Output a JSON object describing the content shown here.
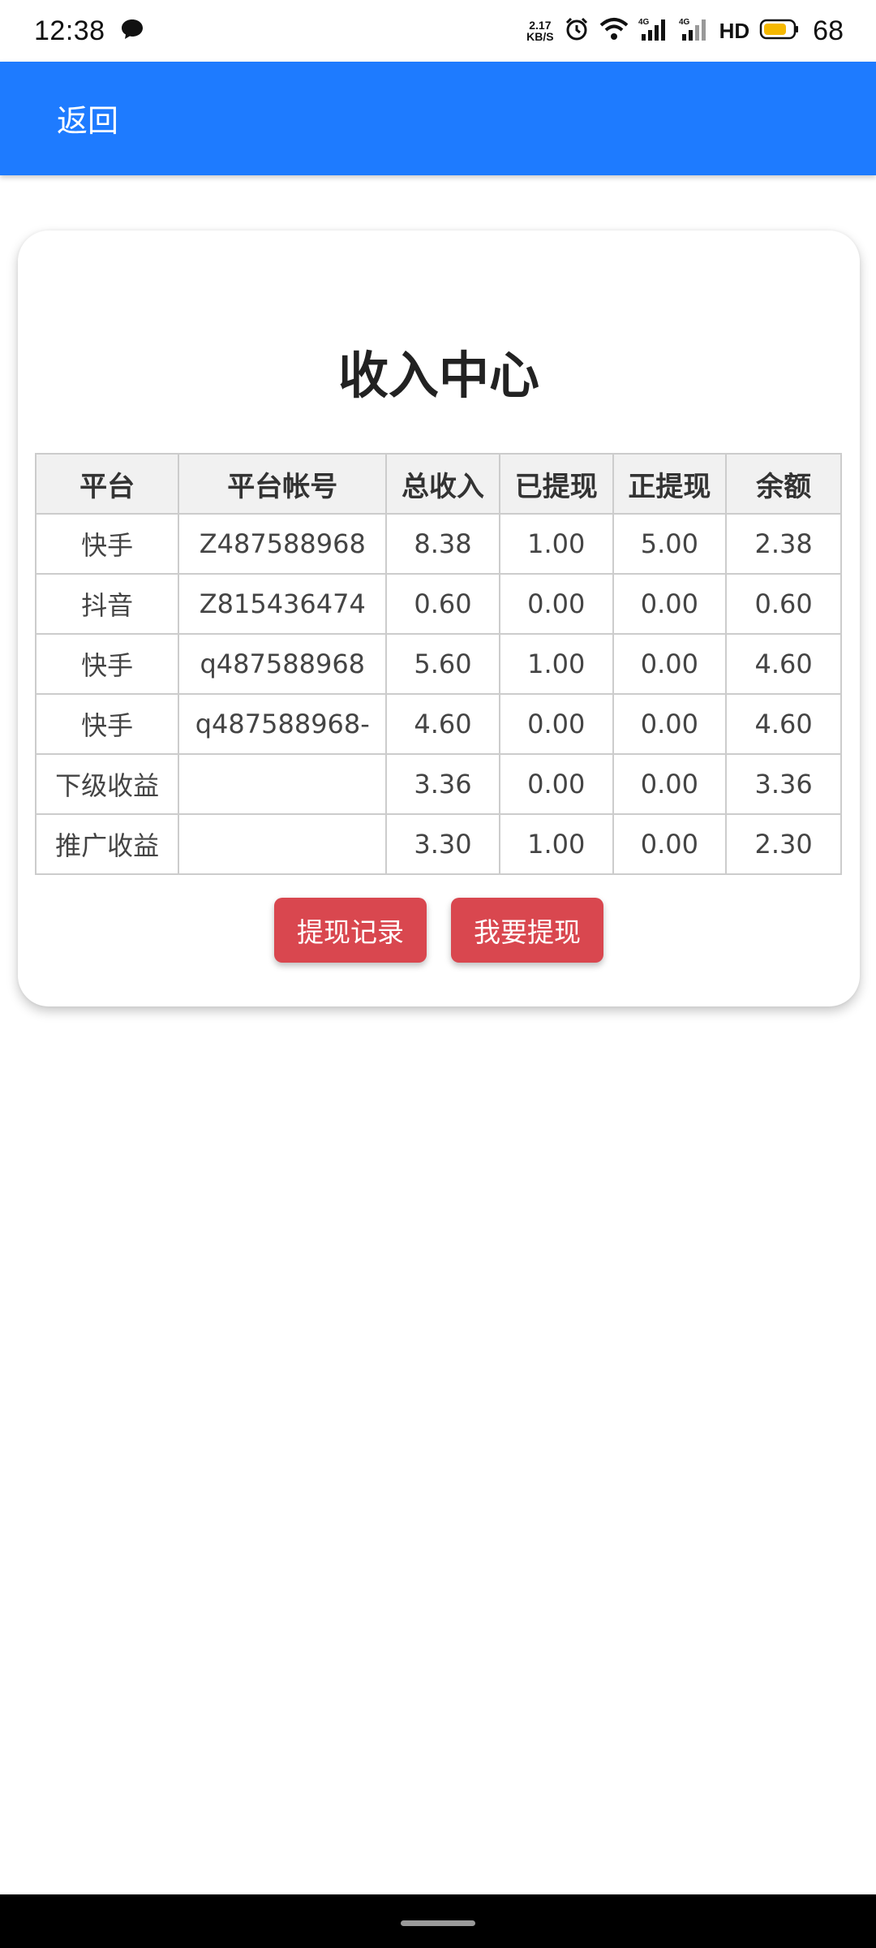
{
  "status_bar": {
    "time": "12:38",
    "net_speed_value": "2.17",
    "net_speed_unit": "KB/S",
    "hd_label": "HD",
    "battery_percent": "68",
    "icons": [
      "message-icon",
      "alarm-icon",
      "wifi-icon",
      "signal-4g-icon",
      "signal-4g-icon",
      "battery-icon"
    ]
  },
  "header": {
    "back_label": "返回",
    "background_color": "#1e7bff"
  },
  "card": {
    "title": "收入中心",
    "table": {
      "headers": [
        "平台",
        "平台帐号",
        "总收入",
        "已提现",
        "正提现",
        "余额"
      ],
      "rows": [
        [
          "快手",
          "Z487588968",
          "8.38",
          "1.00",
          "5.00",
          "2.38"
        ],
        [
          "抖音",
          "Z815436474",
          "0.60",
          "0.00",
          "0.00",
          "0.60"
        ],
        [
          "快手",
          "q487588968",
          "5.60",
          "1.00",
          "0.00",
          "4.60"
        ],
        [
          "快手",
          "q487588968-",
          "4.60",
          "0.00",
          "0.00",
          "4.60"
        ],
        [
          "下级收益",
          "",
          "3.36",
          "0.00",
          "0.00",
          "3.36"
        ],
        [
          "推广收益",
          "",
          "3.30",
          "1.00",
          "0.00",
          "2.30"
        ]
      ]
    },
    "buttons": {
      "withdraw_records": "提现记录",
      "withdraw": "我要提现",
      "color": "#d9474f"
    }
  }
}
